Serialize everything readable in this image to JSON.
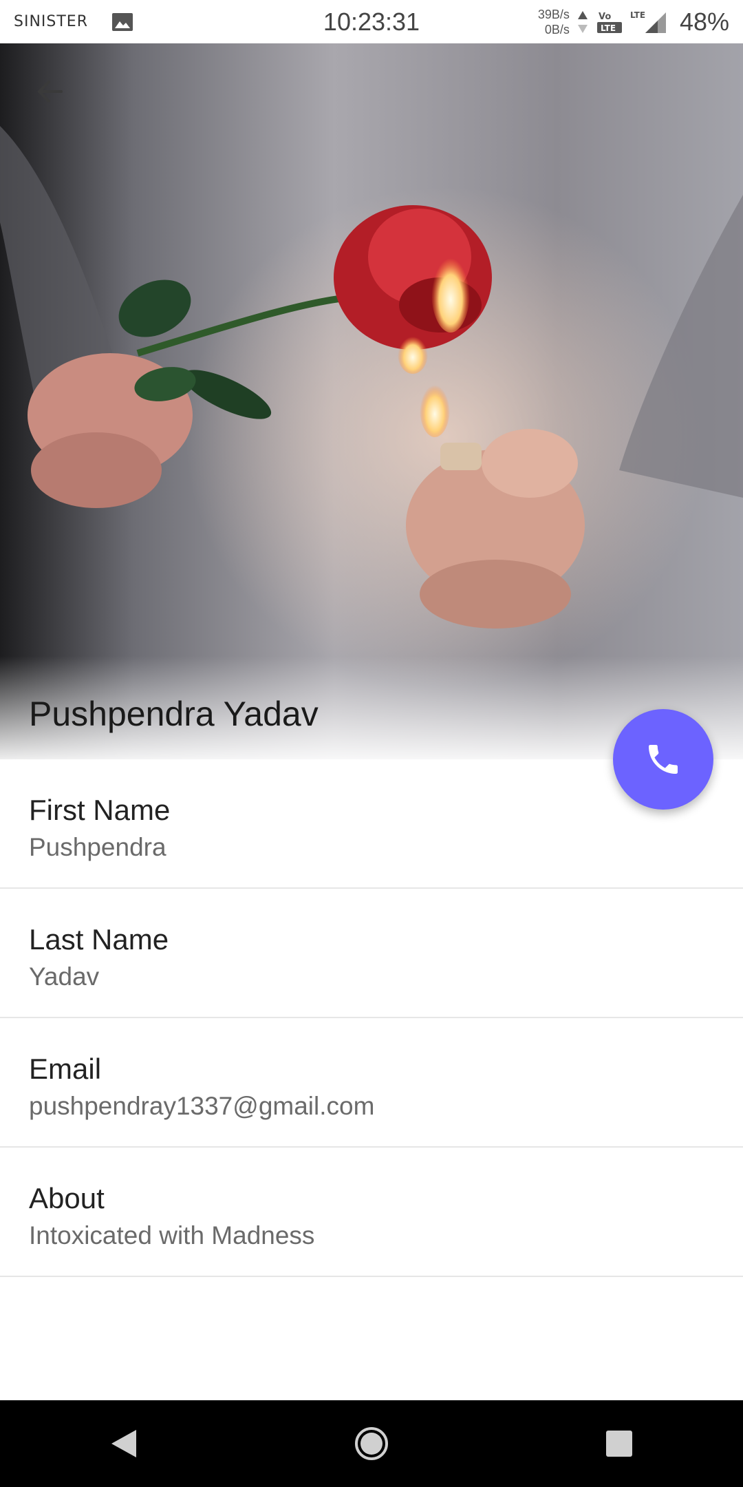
{
  "status_bar": {
    "carrier": "SINISTER",
    "time": "10:23:31",
    "upload_speed": "39B/s",
    "download_speed": "0B/s",
    "battery": "48%",
    "icons": [
      "image-icon",
      "data-arrows-icon",
      "volte-icon",
      "lte-signal-icon"
    ]
  },
  "header": {
    "name": "Pushpendra Yadav",
    "photo_description_icon": "profile-photo",
    "back_icon": "arrow-left-icon"
  },
  "fab": {
    "icon": "phone-icon",
    "color": "#6c63ff"
  },
  "fields": [
    {
      "label": "First Name",
      "value": "Pushpendra"
    },
    {
      "label": "Last Name",
      "value": "Yadav"
    },
    {
      "label": "Email",
      "value": "pushpendray1337@gmail.com"
    },
    {
      "label": "About",
      "value": "Intoxicated with Madness"
    }
  ],
  "nav": {
    "icons": [
      "back-triangle-icon",
      "home-circle-icon",
      "recents-square-icon"
    ]
  }
}
